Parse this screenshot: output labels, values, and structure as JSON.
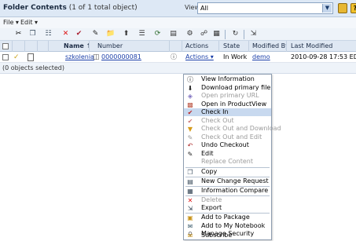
{
  "header": {
    "title": "Folder Contents",
    "subtitle": " (1 of 1 total object)",
    "view_label": "View:",
    "view_value": "All"
  },
  "menubar": {
    "file": "File ▾",
    "edit": "Edit ▾"
  },
  "columns": {
    "name": "Name",
    "sort_indicator": "↑",
    "number": "Number",
    "actions": "Actions",
    "state": "State",
    "modified_by": "Modified By",
    "last_modified": "Last Modified"
  },
  "row": {
    "name": "szkolenia",
    "number": "0000000081",
    "actions": "Actions ▾",
    "state": "In Work",
    "modified_by": "demo",
    "last_modified": "2010-09-28 17:53 EDT"
  },
  "status": "(0 objects selected)",
  "menu": {
    "view_information": "View Information",
    "download_primary_file": "Download primary file",
    "open_primary_url": "Open primary URL",
    "open_in_productview": "Open in ProductView",
    "check_in": "Check In",
    "check_out": "Check Out",
    "check_out_and_download": "Check Out and Download",
    "check_out_and_edit": "Check Out and Edit",
    "undo_checkout": "Undo Checkout",
    "edit": "Edit",
    "replace_content": "Replace Content",
    "copy": "Copy",
    "new_change_request": "New Change Request",
    "information_compare": "Information Compare",
    "delete": "Delete",
    "export": "Export",
    "add_to_package": "Add to Package",
    "add_to_my_notebook": "Add to My Notebook",
    "manage_security": "Manage Security",
    "subscribe": "Subscribe"
  },
  "colors": {
    "header_bg": "#dde8f5",
    "highlight": "#c8d9ef",
    "link": "#1a3ea8"
  }
}
